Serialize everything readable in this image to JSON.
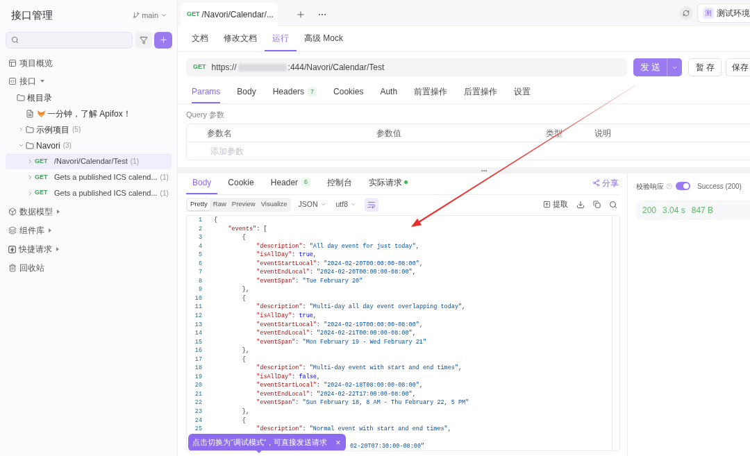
{
  "sidebar": {
    "title": "接口管理",
    "branch": "main",
    "nav": [
      {
        "label": "项目概览"
      },
      {
        "label": "接口",
        "expanded": true,
        "children": [
          {
            "kind": "folder",
            "label": "根目录",
            "children": [
              {
                "kind": "doc",
                "label": "一分钟，了解 Apifox！"
              },
              {
                "kind": "folder",
                "label": "示例项目",
                "count": "(5)",
                "expanded": false
              },
              {
                "kind": "folder",
                "label": "Navori",
                "count": "(3)",
                "expanded": true,
                "children": [
                  {
                    "kind": "endpoint",
                    "method": "GET",
                    "label": "/Navori/Calendar/Test",
                    "count": "(1)",
                    "expanded": false,
                    "selected": true
                  },
                  {
                    "kind": "endpoint",
                    "method": "GET",
                    "label": "Gets a published ICS calend...",
                    "count": "(1)",
                    "expanded": false,
                    "selected": false
                  },
                  {
                    "kind": "endpoint",
                    "method": "GET",
                    "label": "Gets a published ICS calend...",
                    "count": "(1)",
                    "expanded": false,
                    "selected": false
                  }
                ]
              }
            ]
          }
        ]
      },
      {
        "label": "数据模型",
        "expanded": false
      },
      {
        "label": "组件库",
        "expanded": false
      },
      {
        "label": "快捷请求",
        "expanded": false
      },
      {
        "label": "回收站"
      }
    ]
  },
  "request_tab": {
    "method": "GET",
    "title": "/Navori/Calendar/..."
  },
  "environment": {
    "badge": "测",
    "label": "测试环境"
  },
  "view_tabs": [
    {
      "label": "文档",
      "selected": false
    },
    {
      "label": "修改文档",
      "selected": false
    },
    {
      "label": "运行",
      "selected": true
    },
    {
      "label": "高级 Mock",
      "selected": false
    }
  ],
  "url_bar": {
    "method": "GET",
    "url_start": "https://",
    "url_end": ":444/Navori/Calendar/Test"
  },
  "buttons": {
    "send": "发送",
    "draft": "暂存",
    "save": "保存"
  },
  "param_tabs": [
    {
      "label": "Params",
      "selected": true
    },
    {
      "label": "Body",
      "selected": false
    },
    {
      "label": "Headers",
      "badge": "7",
      "selected": false
    },
    {
      "label": "Cookies",
      "selected": false
    },
    {
      "label": "Auth",
      "selected": false
    },
    {
      "label": "前置操作",
      "selected": false
    },
    {
      "label": "后置操作",
      "selected": false
    },
    {
      "label": "设置",
      "selected": false
    }
  ],
  "query": {
    "title": "Query 参数",
    "columns": [
      "参数名",
      "参数值",
      "类型",
      "说明"
    ],
    "placeholder": "添加参数"
  },
  "response": {
    "tabs": [
      {
        "label": "Body",
        "selected": true
      },
      {
        "label": "Cookie",
        "selected": false
      },
      {
        "label": "Header",
        "badge": "6",
        "selected": false
      },
      {
        "label": "控制台",
        "selected": false
      },
      {
        "label": "实际请求",
        "selected": false,
        "live": true
      }
    ],
    "share": "分享",
    "formats": [
      {
        "label": "Pretty",
        "selected": true
      },
      {
        "label": "Raw",
        "selected": false
      },
      {
        "label": "Preview",
        "selected": false
      },
      {
        "label": "Visualize",
        "selected": false
      }
    ],
    "language": "JSON",
    "encoding": "utf8",
    "wrap": true,
    "extract": "提取",
    "code_lines": [
      {
        "number": "1",
        "text": "{"
      },
      {
        "number": "2",
        "text": "    \"events\": ["
      },
      {
        "number": "3",
        "text": "        {"
      },
      {
        "number": "4",
        "text": "            \"description\": \"All day event for just today\","
      },
      {
        "number": "5",
        "text": "            \"isAllDay\": true,"
      },
      {
        "number": "6",
        "text": "            \"eventStartLocal\": \"2024-02-20T00:00:00-08:00\","
      },
      {
        "number": "7",
        "text": "            \"eventEndLocal\": \"2024-02-20T00:00:00-08:00\","
      },
      {
        "number": "8",
        "text": "            \"eventSpan\": \"Tue February 20\""
      },
      {
        "number": "9",
        "text": "        },"
      },
      {
        "number": "10",
        "text": "        {"
      },
      {
        "number": "11",
        "text": "            \"description\": \"Multi-day all day event overlapping today\","
      },
      {
        "number": "12",
        "text": "            \"isAllDay\": true,"
      },
      {
        "number": "13",
        "text": "            \"eventStartLocal\": \"2024-02-19T00:00:00-08:00\","
      },
      {
        "number": "14",
        "text": "            \"eventEndLocal\": \"2024-02-21T00:00:00-08:00\","
      },
      {
        "number": "15",
        "text": "            \"eventSpan\": \"Mon February 19 - Wed February 21\""
      },
      {
        "number": "16",
        "text": "        },"
      },
      {
        "number": "17",
        "text": "        {"
      },
      {
        "number": "18",
        "text": "            \"description\": \"Multi-day event with start and end times\","
      },
      {
        "number": "19",
        "text": "            \"isAllDay\": false,"
      },
      {
        "number": "20",
        "text": "            \"eventStartLocal\": \"2024-02-18T08:00:00-08:00\","
      },
      {
        "number": "21",
        "text": "            \"eventEndLocal\": \"2024-02-22T17:00:00-08:00\","
      },
      {
        "number": "22",
        "text": "            \"eventSpan\": \"Sun February 18, 8 AM - Thu February 22, 5 PM\""
      },
      {
        "number": "23",
        "text": "        },"
      },
      {
        "number": "24",
        "text": "        {"
      },
      {
        "number": "25",
        "text": "            \"description\": \"Normal event with start and end times\","
      }
    ],
    "hidden_line_tail": "02-20T07:30:00-08:00\""
  },
  "validation": {
    "label": "校验响应",
    "on": true,
    "result": "Success (200)"
  },
  "stats": [
    "200",
    "3.04 s",
    "847 B"
  ],
  "toast": {
    "message": "点击切换为“调试模式”，可直接发送请求",
    "close": "×"
  }
}
